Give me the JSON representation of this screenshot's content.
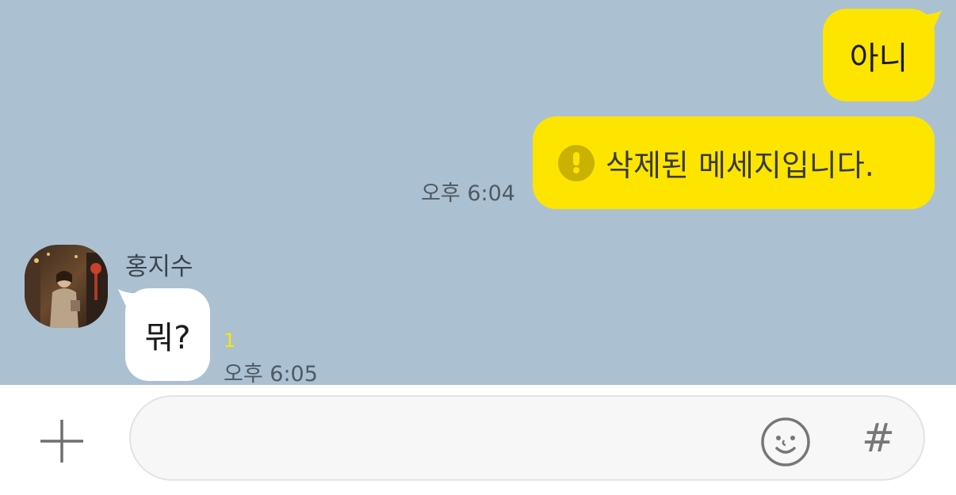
{
  "messages": {
    "outgoing": [
      {
        "text": "아니"
      },
      {
        "text": "삭제된 메세지입니다.",
        "deleted": true,
        "time": "오후 6:04"
      }
    ],
    "incoming": {
      "sender": "홍지수",
      "text": "뭐?",
      "unread_count": "1",
      "time": "오후 6:05"
    }
  },
  "input_bar": {
    "placeholder": "",
    "hash_label": "#"
  },
  "colors": {
    "chat_background": "#abc1d1",
    "outgoing_bubble": "#fee500",
    "incoming_bubble": "#ffffff",
    "unread_badge": "#fee500"
  },
  "icons": {
    "attach": "plus-icon",
    "emoji": "emoji-icon",
    "warning": "exclamation-circle-icon"
  }
}
